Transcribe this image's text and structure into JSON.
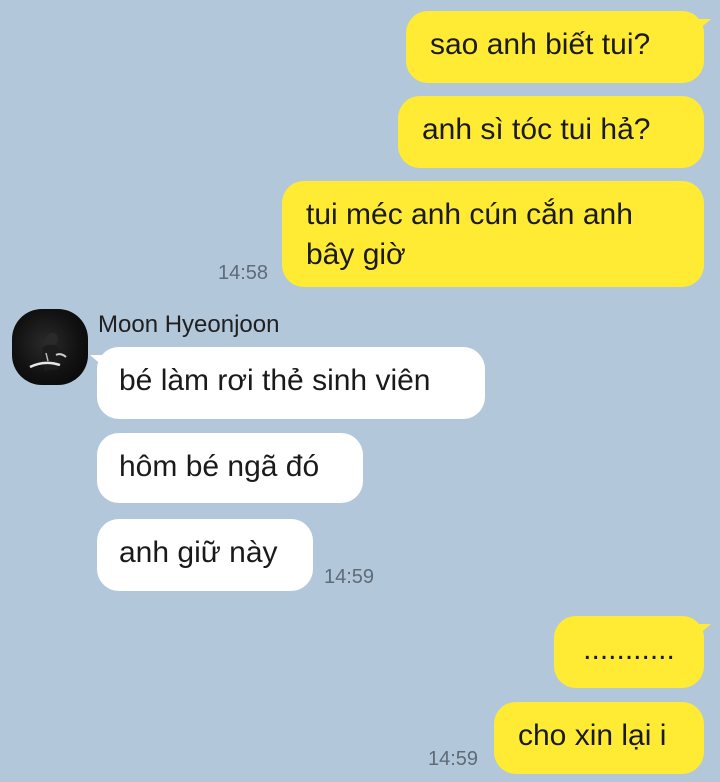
{
  "messages_me_top": [
    {
      "text": "sao anh biết tui?"
    },
    {
      "text": "anh sì tóc tui hả?"
    },
    {
      "text": "tui méc anh cún cắn anh bây giờ"
    }
  ],
  "time_me_top": "14:58",
  "contact": {
    "name": "Moon Hyeonjoon",
    "avatar_icon": "profile-photo"
  },
  "messages_other": [
    {
      "text": "bé làm rơi thẻ sinh viên"
    },
    {
      "text": "hôm bé ngã đó"
    },
    {
      "text": "anh giữ này"
    }
  ],
  "time_other": "14:59",
  "messages_me_bottom": [
    {
      "text": "..........."
    },
    {
      "text": "cho xin lại i"
    }
  ],
  "time_me_bottom": "14:59",
  "colors": {
    "background": "#b2c7da",
    "my_bubble": "#ffeb33",
    "their_bubble": "#ffffff"
  }
}
